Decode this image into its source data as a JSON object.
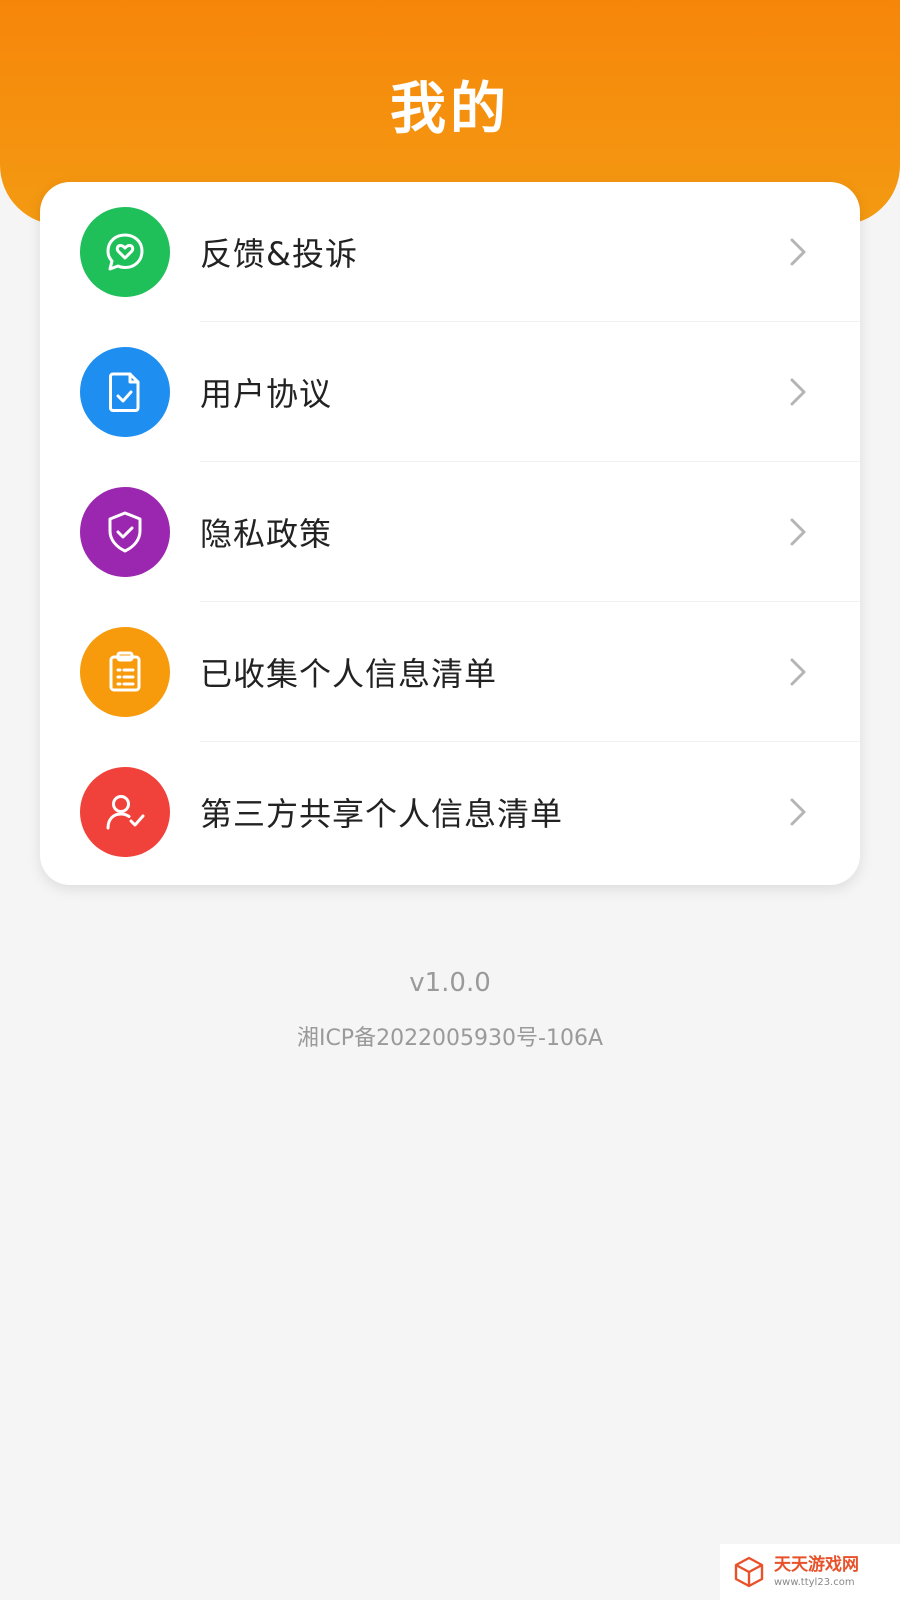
{
  "header": {
    "title": "我的",
    "gradient_top": "#f6860a",
    "gradient_bottom": "#f49a12"
  },
  "menu": {
    "items": [
      {
        "label": "反馈&投诉",
        "icon": "heart-chat-icon",
        "color": "#1fbf5a"
      },
      {
        "label": "用户协议",
        "icon": "document-check-icon",
        "color": "#1e8ef0"
      },
      {
        "label": "隐私政策",
        "icon": "shield-check-icon",
        "color": "#9b27b0"
      },
      {
        "label": "已收集个人信息清单",
        "icon": "clipboard-list-icon",
        "color": "#f79a0c"
      },
      {
        "label": "第三方共享个人信息清单",
        "icon": "user-check-icon",
        "color": "#f0413a"
      }
    ]
  },
  "footer": {
    "version": "v1.0.0",
    "icp": "湘ICP备2022005930号-106A"
  },
  "watermark": {
    "text": "天天游戏网",
    "url": "www.ttyl23.com"
  }
}
